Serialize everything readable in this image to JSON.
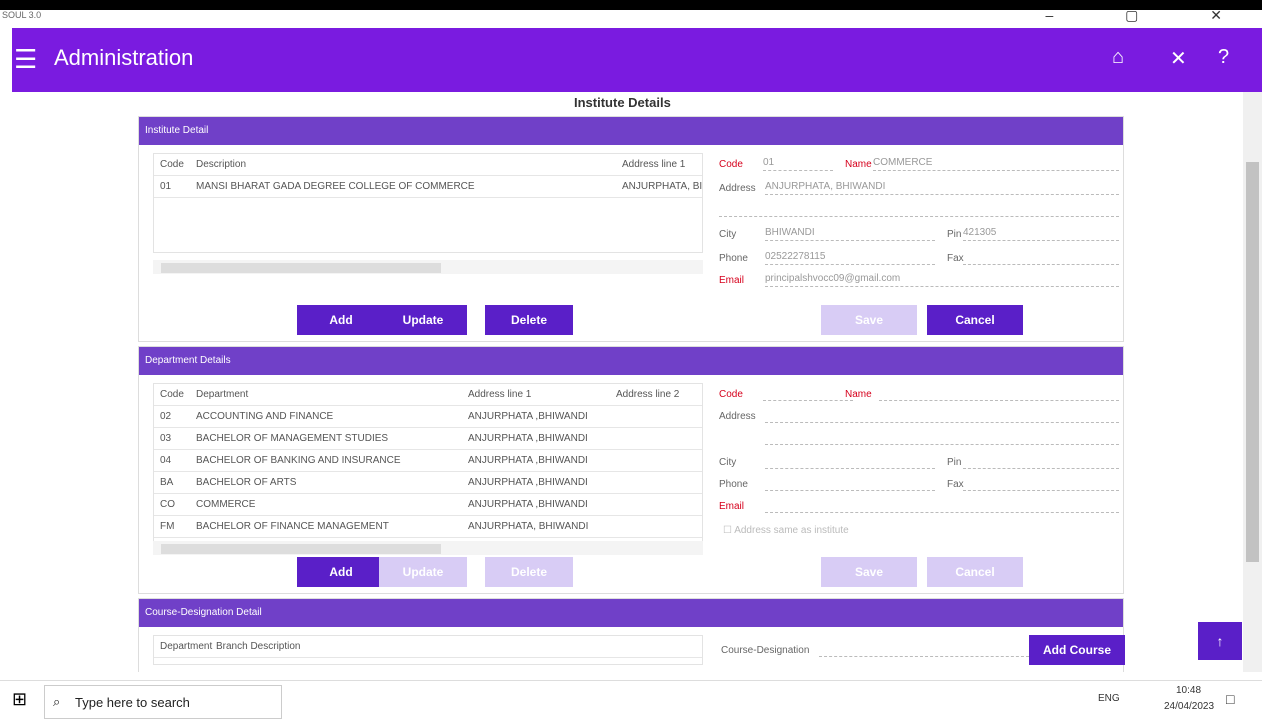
{
  "window": {
    "app_title": "SOUL 3.0",
    "controls": "‒ ▢ ✕"
  },
  "appbar": {
    "menu_icon": "☰",
    "title": "Administration",
    "home_icon": "⌂",
    "close_icon": "✕",
    "help_icon": "?"
  },
  "page": {
    "title": "Institute Details"
  },
  "institute": {
    "header": "Institute Detail",
    "columns": [
      "Code",
      "Description",
      "Address line 1"
    ],
    "rows": [
      [
        "01",
        "MANSI BHARAT GADA DEGREE COLLEGE OF COMMERCE",
        "ANJURPHATA, BI"
      ]
    ],
    "buttons": {
      "add": "Add",
      "update": "Update",
      "delete": "Delete",
      "save": "Save",
      "cancel": "Cancel"
    },
    "form": {
      "code_label": "Code",
      "code_value": "01",
      "name_label": "Name",
      "name_value": "COMMERCE",
      "address_label": "Address",
      "address_value": "ANJURPHATA, BHIWANDI",
      "city_label": "City",
      "city_value": "BHIWANDI",
      "pin_label": "Pin",
      "pin_value": "421305",
      "phone_label": "Phone",
      "phone_value": "02522278115",
      "fax_label": "Fax",
      "email_label": "Email",
      "email_value": "principalshvocc09@gmail.com"
    }
  },
  "department": {
    "header": "Department Details",
    "columns": [
      "Code",
      "Department",
      "Address line 1",
      "Address line 2"
    ],
    "rows": [
      [
        "02",
        "ACCOUNTING AND FINANCE",
        "ANJURPHATA ,BHIWANDI"
      ],
      [
        "03",
        "BACHELOR OF MANAGEMENT STUDIES",
        "ANJURPHATA ,BHIWANDI"
      ],
      [
        "04",
        "BACHELOR OF BANKING AND INSURANCE",
        "ANJURPHATA ,BHIWANDI"
      ],
      [
        "BA",
        "BACHELOR OF ARTS",
        "ANJURPHATA ,BHIWANDI"
      ],
      [
        "CO",
        "COMMERCE",
        "ANJURPHATA ,BHIWANDI"
      ],
      [
        "FM",
        "BACHELOR OF FINANCE MANAGEMENT",
        "ANJURPHATA, BHIWANDI"
      ]
    ],
    "buttons": {
      "add": "Add",
      "update": "Update",
      "delete": "Delete",
      "save": "Save",
      "cancel": "Cancel"
    },
    "form": {
      "code_label": "Code",
      "name_label": "Name",
      "address_label": "Address",
      "city_label": "City",
      "pin_label": "Pin",
      "phone_label": "Phone",
      "fax_label": "Fax",
      "email_label": "Email",
      "same_as_institute": "Address same as institute"
    }
  },
  "course": {
    "header": "Course-Designation Detail",
    "columns": [
      "Department",
      "Branch Description"
    ],
    "designation_label": "Course-Designation",
    "add_course": "Add Course"
  },
  "fab": {
    "icon": "↑"
  },
  "taskbar": {
    "search_placeholder": "Type here to search",
    "lang": "ENG",
    "time": "10:48",
    "date": "24/04/2023"
  }
}
